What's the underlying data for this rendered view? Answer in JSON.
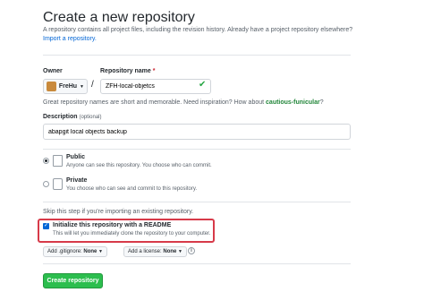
{
  "header": {
    "title": "Create a new repository",
    "intro": "A repository contains all project files, including the revision history. Already have a project repository elsewhere?",
    "import_link": "Import a repository."
  },
  "owner": {
    "label": "Owner",
    "name": "FreHu"
  },
  "repo": {
    "label": "Repository name",
    "required_mark": "*",
    "value": "ZFH-local-objetcs"
  },
  "hint": {
    "prefix": "Great repository names are short and memorable. Need inspiration? How about ",
    "suggestion": "cautious-funicular",
    "suffix": "?"
  },
  "description": {
    "label": "Description",
    "optional": "(optional)",
    "value": "abapgit local objects backup"
  },
  "visibility": {
    "public": {
      "title": "Public",
      "desc": "Anyone can see this repository. You choose who can commit.",
      "selected": true
    },
    "private": {
      "title": "Private",
      "desc": "You choose who can see and commit to this repository.",
      "selected": false
    }
  },
  "skip_note": "Skip this step if you're importing an existing repository.",
  "init": {
    "checked": true,
    "label": "Initialize this repository with a README",
    "desc": "This will let you immediately clone the repository to your computer."
  },
  "gitignore": {
    "prefix": "Add .gitignore:",
    "value": "None"
  },
  "license": {
    "prefix": "Add a license:",
    "value": "None"
  },
  "create_button": "Create repository",
  "colors": {
    "primary_button": "#2cbe4e",
    "link": "#0366d6",
    "highlight": "#d73a49",
    "suggestion": "#22863a"
  }
}
